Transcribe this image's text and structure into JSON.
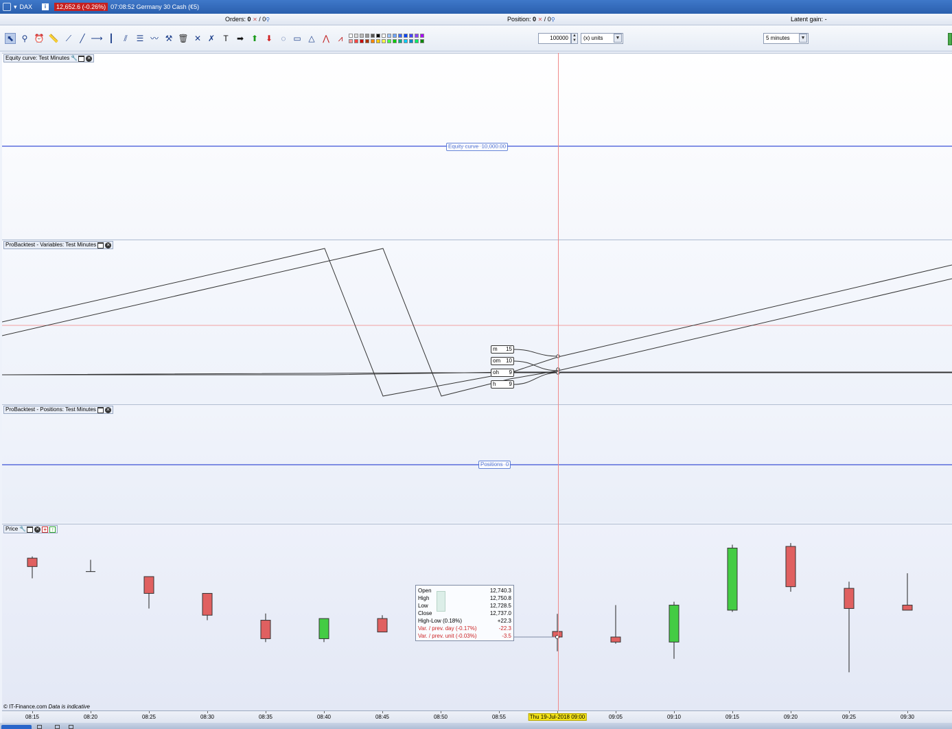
{
  "titlebar": {
    "instrument": "DAX",
    "price_badge": "12,652.6 (-0.26%)",
    "title": "07:08:52 Germany 30 Cash (€5)"
  },
  "infobar": {
    "orders_label": "Orders:",
    "orders_value": "0",
    "orders_total": "/ 0",
    "position_label": "Position:",
    "position_value": "0",
    "position_total": "/ 0",
    "latent_label": "Latent gain:",
    "latent_value": "-"
  },
  "toolbar": {
    "tool_icons": [
      "cursor-icon",
      "zoom-icon",
      "alert-icon",
      "ruler-icon",
      "segment-icon",
      "line-icon",
      "horizontal-line-icon",
      "vertical-line-icon",
      "channel-icon",
      "fibonacci-icon",
      "trend-icon",
      "magnet-icon",
      "trash-icon",
      "cross-icon",
      "cross2-icon",
      "text-icon",
      "arrow-right-icon",
      "arrow-up-icon",
      "arrow-down-icon",
      "lasso-icon",
      "rectangle-icon",
      "triangle-icon",
      "chart-pattern-icon",
      "warn-pattern-icon"
    ],
    "quantity_value": "100000",
    "units_label": "(x) units",
    "timeframe_label": "5 minutes",
    "palette_top": [
      "#ffffff",
      "#dddddd",
      "#bbbbbb",
      "#999999",
      "#555555",
      "#000000",
      "#ffffff",
      "#9ec6ff",
      "#6ea6ff",
      "#3b6bff",
      "#0044ff",
      "#4444ff",
      "#8844ff",
      "#aa00ff"
    ],
    "palette_bottom": [
      "#ff9999",
      "#ff4444",
      "#cc0000",
      "#aa3300",
      "#ff8800",
      "#ffcc00",
      "#ffff44",
      "#44ff44",
      "#00cc00",
      "#00aa88",
      "#00ccff",
      "#0088cc",
      "#00ee66",
      "#008800"
    ]
  },
  "panels": {
    "equity": {
      "title": "Equity curve: Test Minutes",
      "chip_label": "Equity curve",
      "chip_value": "10,000.00"
    },
    "variables": {
      "title": "ProBacktest - Variables: Test Minutes",
      "labels": [
        {
          "name": "m",
          "value": "15"
        },
        {
          "name": "om",
          "value": "10"
        },
        {
          "name": "oh",
          "value": "9"
        },
        {
          "name": "h",
          "value": "9"
        }
      ]
    },
    "positions": {
      "title": "ProBacktest - Positions: Test Minutes",
      "chip_label": "Positions",
      "chip_value": "0"
    },
    "price": {
      "title": "Price"
    }
  },
  "ohlc_tooltip": {
    "open_label": "Open",
    "open_value": "12,740.3",
    "high_label": "High",
    "high_value": "12,750.8",
    "low_label": "Low",
    "low_value": "12,728.5",
    "close_label": "Close",
    "close_value": "12,737.0",
    "hl_label": "High-Low (0.18%)",
    "hl_value": "+22.3",
    "var_day_label": "Var. / prev. day (-0.17%)",
    "var_day_value": "-22.3",
    "var_unit_label": "Var. / prev. unit (-0.03%)",
    "var_unit_value": "-3.5"
  },
  "chart_data": {
    "type": "candlestick",
    "title": "Price",
    "x": [
      "08:15",
      "08:20",
      "08:25",
      "08:30",
      "08:35",
      "08:40",
      "08:45",
      "08:50",
      "08:55",
      "Thu 19-Jul-2018 09:00",
      "09:05",
      "09:10",
      "09:15",
      "09:20",
      "09:25",
      "09:30"
    ],
    "candles": [
      {
        "t": "08:15",
        "o": 12784,
        "h": 12785,
        "l": 12772,
        "c": 12779
      },
      {
        "t": "08:20",
        "o": 12776,
        "h": 12783,
        "l": 12776,
        "c": 12776
      },
      {
        "t": "08:25",
        "o": 12773,
        "h": 12773,
        "l": 12754,
        "c": 12763
      },
      {
        "t": "08:30",
        "o": 12763,
        "h": 12763,
        "l": 12747,
        "c": 12750
      },
      {
        "t": "08:35",
        "o": 12747,
        "h": 12751,
        "l": 12734,
        "c": 12736
      },
      {
        "t": "08:40",
        "o": 12736,
        "h": 12748,
        "l": 12734,
        "c": 12748
      },
      {
        "t": "08:45",
        "o": 12748,
        "h": 12750,
        "l": 12740,
        "c": 12740
      },
      {
        "t": "Thu 19-Jul-2018 09:00",
        "o": 12740.3,
        "h": 12750.8,
        "l": 12728.5,
        "c": 12737.0
      },
      {
        "t": "09:05",
        "o": 12737,
        "h": 12756,
        "l": 12733,
        "c": 12734
      },
      {
        "t": "09:10",
        "o": 12734,
        "h": 12758,
        "l": 12724,
        "c": 12756
      },
      {
        "t": "09:15",
        "o": 12753,
        "h": 12792,
        "l": 12752,
        "c": 12790
      },
      {
        "t": "09:20",
        "o": 12791,
        "h": 12793,
        "l": 12764,
        "c": 12767
      },
      {
        "t": "09:25",
        "o": 12766,
        "h": 12770,
        "l": 12716,
        "c": 12754
      },
      {
        "t": "09:30",
        "o": 12756,
        "h": 12775,
        "l": 12753,
        "c": 12753
      }
    ],
    "up_color": "#44cc44",
    "down_color": "#e06060",
    "cursor_label": "Thu 19-Jul-2018 09:00"
  },
  "footer": {
    "copyright": "© IT-Finance.com",
    "disclaimer": "Data is indicative"
  }
}
